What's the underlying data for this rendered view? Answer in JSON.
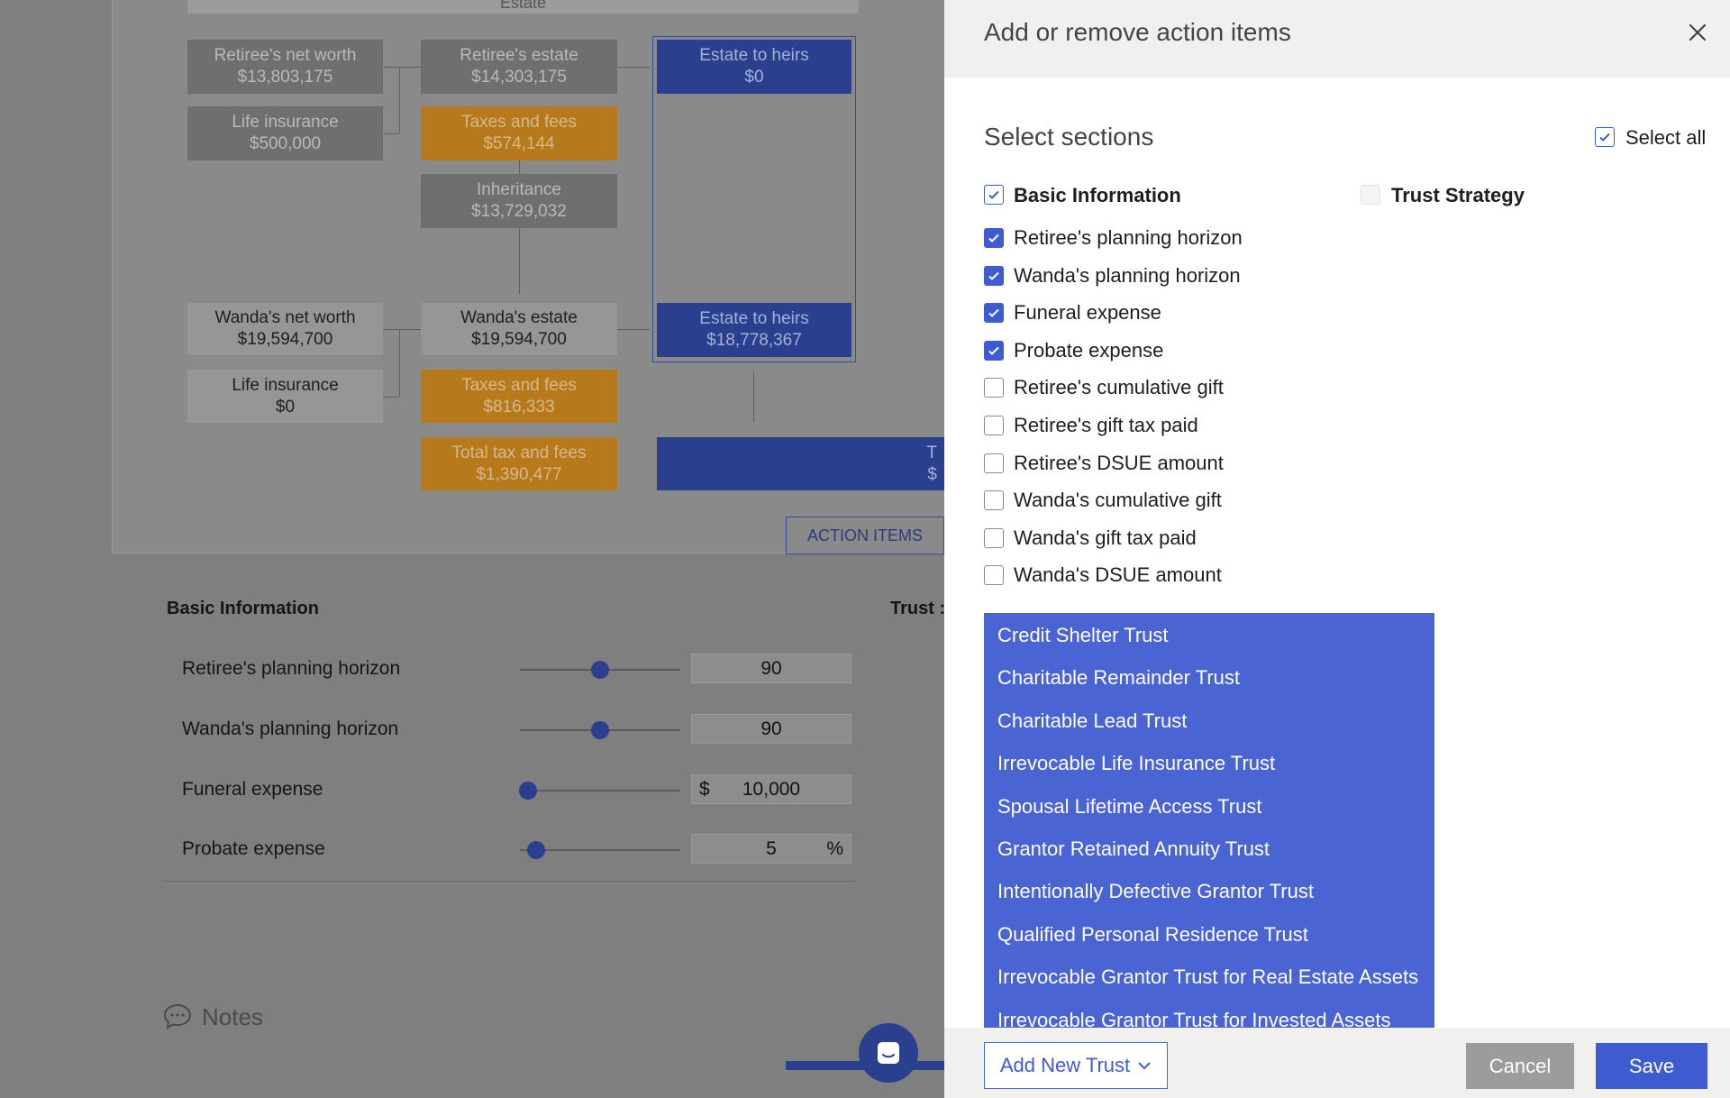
{
  "diagram": {
    "top_label": "Estate",
    "boxes": {
      "retiree_net_worth": {
        "label": "Retiree's net worth",
        "value": "$13,803,175"
      },
      "retiree_life_insurance": {
        "label": "Life insurance",
        "value": "$500,000"
      },
      "retiree_estate": {
        "label": "Retiree's estate",
        "value": "$14,303,175"
      },
      "retiree_taxes": {
        "label": "Taxes and fees",
        "value": "$574,144"
      },
      "inheritance": {
        "label": "Inheritance",
        "value": "$13,729,032"
      },
      "estate_heirs_1": {
        "label": "Estate to heirs",
        "value": "$0"
      },
      "wanda_net_worth": {
        "label": "Wanda's net worth",
        "value": "$19,594,700"
      },
      "wanda_life_insurance": {
        "label": "Life insurance",
        "value": "$0"
      },
      "wanda_estate": {
        "label": "Wanda's estate",
        "value": "$19,594,700"
      },
      "wanda_taxes": {
        "label": "Taxes and fees",
        "value": "$816,333"
      },
      "total_tax": {
        "label": "Total tax and fees",
        "value": "$1,390,477"
      },
      "estate_heirs_2": {
        "label": "Estate to heirs",
        "value": "$18,778,367"
      },
      "total_partial": {
        "line1": "T",
        "line2": "$"
      }
    }
  },
  "action_items_button": "ACTION ITEMS",
  "basic_info": {
    "title": "Basic Information",
    "trust_title_partial": "Trust :",
    "rows": [
      {
        "label": "Retiree's planning horizon",
        "value": "90",
        "prefix": "",
        "suffix": "",
        "slider": 0.5
      },
      {
        "label": "Wanda's planning horizon",
        "value": "90",
        "prefix": "",
        "suffix": "",
        "slider": 0.5
      },
      {
        "label": "Funeral expense",
        "value": "10,000",
        "prefix": "$",
        "suffix": "",
        "slider": 0.05
      },
      {
        "label": "Probate expense",
        "value": "5",
        "prefix": "",
        "suffix": "%",
        "slider": 0.1
      }
    ]
  },
  "notes_label": "Notes",
  "panel": {
    "title": "Add or remove action items",
    "select_sections": "Select sections",
    "select_all": "Select all",
    "section_basic": "Basic Information",
    "section_trust": "Trust Strategy",
    "items": [
      {
        "label": "Retiree's planning horizon",
        "checked": true
      },
      {
        "label": "Wanda's planning horizon",
        "checked": true
      },
      {
        "label": "Funeral expense",
        "checked": true
      },
      {
        "label": "Probate expense",
        "checked": true
      },
      {
        "label": "Retiree's cumulative gift",
        "checked": false
      },
      {
        "label": "Retiree's gift tax paid",
        "checked": false
      },
      {
        "label": "Retiree's DSUE amount",
        "checked": false
      },
      {
        "label": "Wanda's cumulative gift",
        "checked": false
      },
      {
        "label": "Wanda's gift tax paid",
        "checked": false
      },
      {
        "label": "Wanda's DSUE amount",
        "checked": false
      }
    ],
    "trust_options": [
      "Credit Shelter Trust",
      "Charitable Remainder Trust",
      "Charitable Lead Trust",
      "Irrevocable Life Insurance Trust",
      "Spousal Lifetime Access Trust",
      "Grantor Retained Annuity Trust",
      "Intentionally Defective Grantor Trust",
      "Qualified Personal Residence Trust",
      "Irrevocable Grantor Trust for Real Estate Assets",
      "Irrevocable Grantor Trust for Invested Assets"
    ],
    "add_new_trust": "Add New Trust",
    "cancel": "Cancel",
    "save": "Save"
  },
  "colors": {
    "accent": "#3f5bd1",
    "dropdown": "#4a64d4",
    "orange": "#b67a1c",
    "navy": "#2b3f8f"
  }
}
